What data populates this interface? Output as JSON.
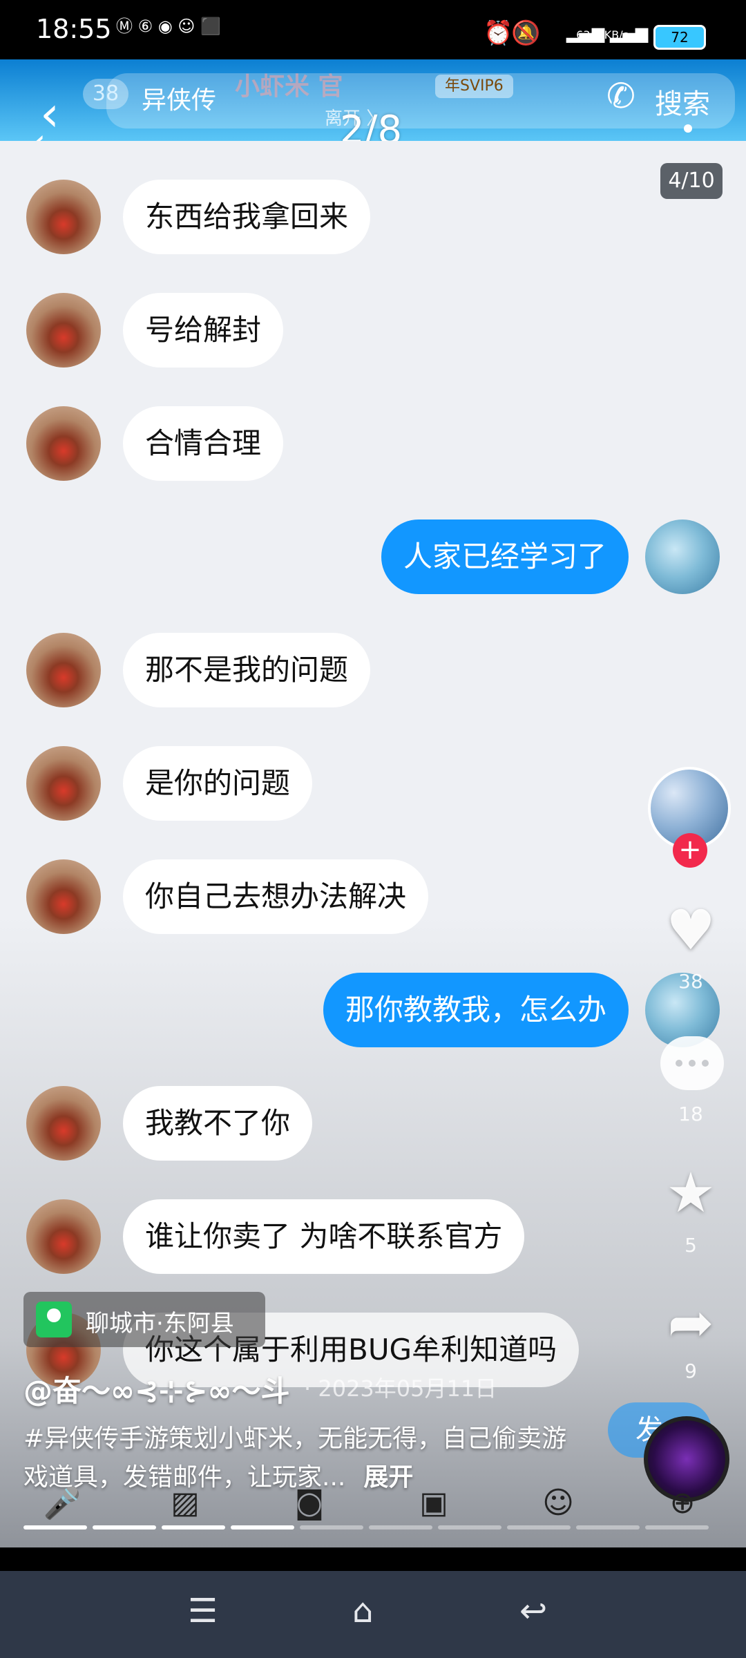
{
  "status_bar": {
    "time": "18:55",
    "battery": "72",
    "net_speed": "63.1 KB/s"
  },
  "header": {
    "unread_count": "38",
    "search_title": "异侠传",
    "overlay_title": "小虾米 官",
    "svip": "年SVIP6",
    "leave": "离开 〉",
    "pager": "2/8",
    "search_label": "搜索"
  },
  "image_counter": "4/10",
  "messages": [
    {
      "side": "them",
      "text": "东西给我拿回来"
    },
    {
      "side": "them",
      "text": "号给解封"
    },
    {
      "side": "them",
      "text": "合情合理"
    },
    {
      "side": "me",
      "text": "人家已经学习了"
    },
    {
      "side": "them",
      "text": "那不是我的问题"
    },
    {
      "side": "them",
      "text": "是你的问题"
    },
    {
      "side": "them",
      "text": "你自己去想办法解决"
    },
    {
      "side": "me",
      "text": "那你教教我，怎么办"
    },
    {
      "side": "them",
      "text": "我教不了你"
    },
    {
      "side": "them",
      "text": "谁让你卖了 为啥不联系官方"
    },
    {
      "side": "them",
      "text": "你这个属于利用BUG牟利知道吗"
    }
  ],
  "side_actions": {
    "likes": "38",
    "comments": "18",
    "favorites": "5",
    "shares": "9"
  },
  "location": "聊城市·东阿县",
  "author": "@奋〜∞⊰⊹⊱∞〜斗",
  "date": "· 2023年05月11日",
  "description": "#异侠传手游策划小虾米，无能无得，自己偷卖游戏道具，发错邮件，让玩家...",
  "expand_label": "展开",
  "send_label": "发",
  "icons": [
    "mic-icon",
    "image-icon",
    "camera-icon",
    "red-packet-icon",
    "emoji-icon",
    "plus-icon"
  ],
  "colors": {
    "header_blue": "#0c7fd2",
    "bubble_me": "#1297ff",
    "follow_red": "#f2294c"
  }
}
